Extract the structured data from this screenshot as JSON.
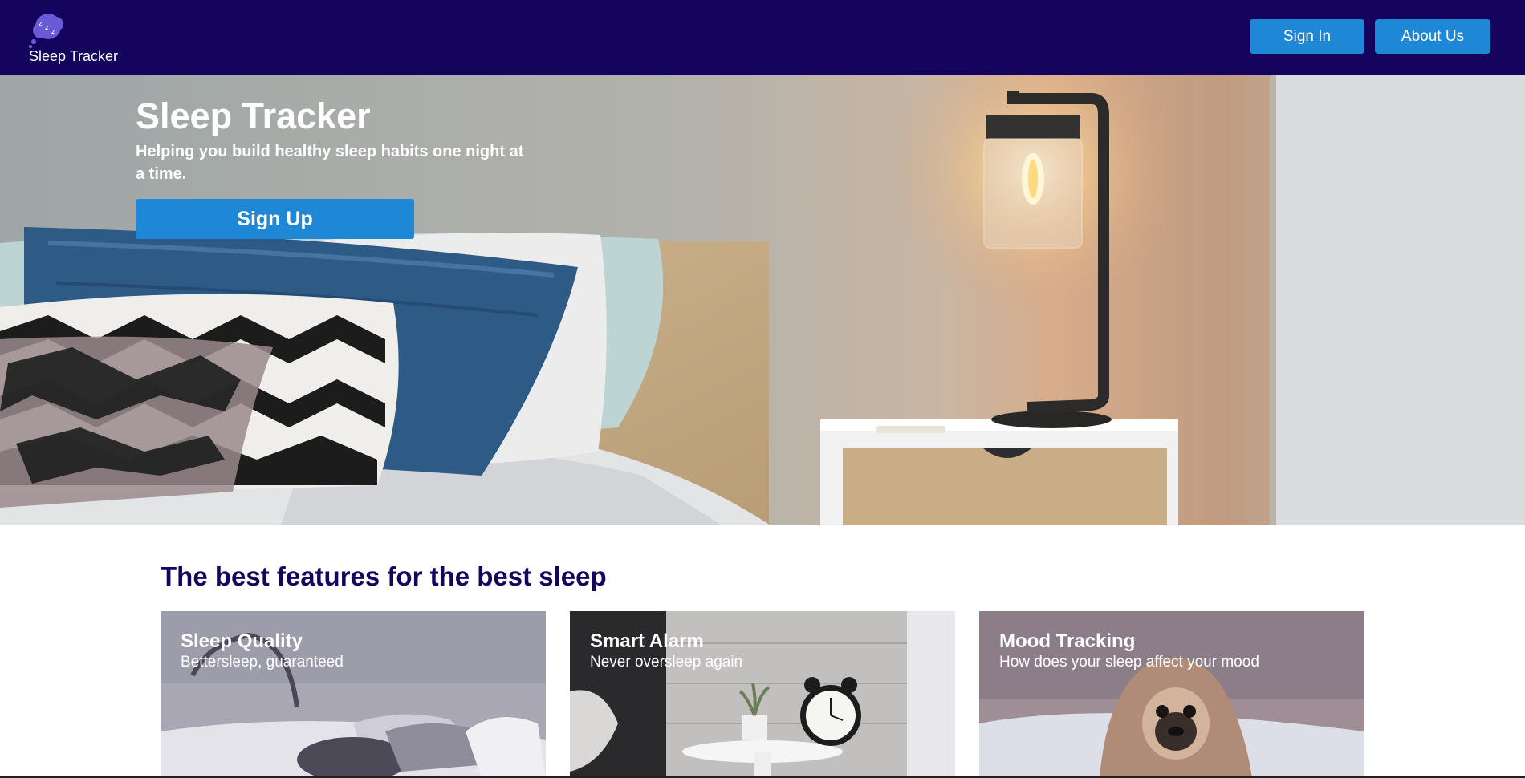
{
  "header": {
    "logo_text": "Sleep Tracker",
    "logo_icon": "zzz-cloud-icon",
    "nav": {
      "sign_in": "Sign In",
      "about_us": "About Us"
    }
  },
  "hero": {
    "title": "Sleep Tracker",
    "subtitle": "Helping you build healthy sleep habits one night at a time.",
    "cta": "Sign Up"
  },
  "features": {
    "heading": "The best features for the best sleep",
    "cards": [
      {
        "title": "Sleep Quality",
        "subtitle": "Bettersleep, guaranteed"
      },
      {
        "title": "Smart Alarm",
        "subtitle": "Never oversleep again"
      },
      {
        "title": "Mood Tracking",
        "subtitle": "How does your sleep affect your mood"
      }
    ]
  },
  "colors": {
    "header_bg": "#15045d",
    "button": "#1e88d6",
    "heading": "#15045d",
    "logo_cloud": "#6b5ad6"
  }
}
